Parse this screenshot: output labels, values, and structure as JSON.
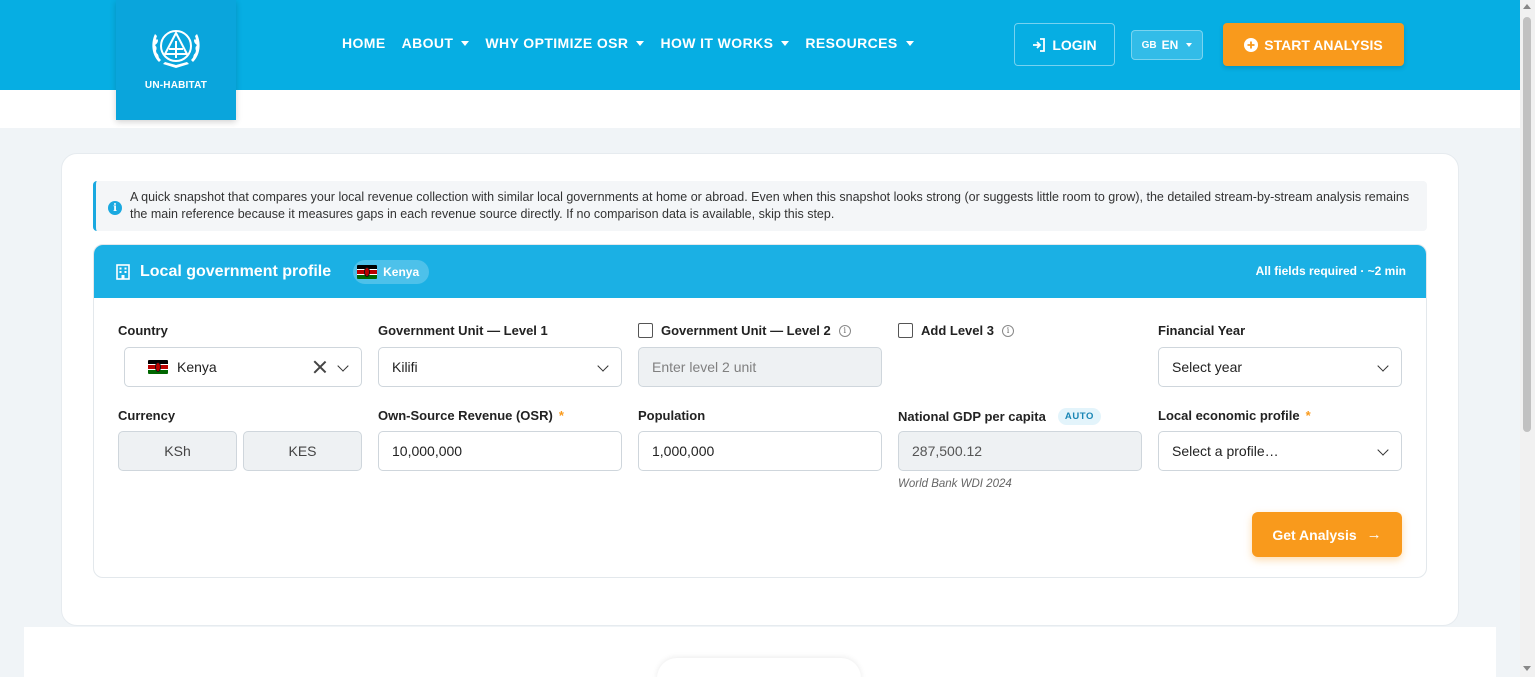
{
  "header": {
    "logo_text": "UN-HABITAT",
    "nav": [
      {
        "label": "HOME",
        "has_dropdown": false
      },
      {
        "label": "ABOUT",
        "has_dropdown": true
      },
      {
        "label": "WHY OPTIMIZE OSR",
        "has_dropdown": true
      },
      {
        "label": "HOW IT WORKS",
        "has_dropdown": true
      },
      {
        "label": "RESOURCES",
        "has_dropdown": true
      }
    ],
    "login_label": "LOGIN",
    "lang_flag": "GB",
    "lang_code": "EN",
    "start_label": "START ANALYSIS"
  },
  "info": {
    "text": "A quick snapshot that compares your local revenue collection with similar local governments at home or abroad. Even when this snapshot looks strong (or suggests little room to grow), the detailed stream-by-stream analysis remains the main reference because it measures gaps in each revenue source directly. If no comparison data is available, skip this step."
  },
  "panel": {
    "title": "Local government profile",
    "country_chip": "Kenya",
    "note": "All fields required · ~2 min"
  },
  "form": {
    "country": {
      "label": "Country",
      "value": "Kenya"
    },
    "level1": {
      "label": "Government Unit — Level 1",
      "value": "Kilifi"
    },
    "level2": {
      "label": "Government Unit — Level 2",
      "placeholder": "Enter level 2 unit"
    },
    "level3": {
      "label": "Add Level 3"
    },
    "year": {
      "label": "Financial Year",
      "placeholder": "Select year"
    },
    "currency": {
      "label": "Currency",
      "symbol": "KSh",
      "code": "KES"
    },
    "osr": {
      "label": "Own-Source Revenue (OSR)",
      "required_mark": "*",
      "value": "10,000,000"
    },
    "population": {
      "label": "Population",
      "value": "1,000,000"
    },
    "gdp": {
      "label": "National GDP per capita",
      "badge": "AUTO",
      "value": "287,500.12",
      "source": "World Bank WDI 2024"
    },
    "profile": {
      "label": "Local economic profile",
      "required_mark": "*",
      "placeholder": "Select a profile…"
    }
  },
  "actions": {
    "get_analysis": "Get Analysis",
    "get_analysis_arrow": "→"
  },
  "colors": {
    "header_blue": "#06aee3",
    "accent_orange": "#f99a1c",
    "panel_blue": "#1bb0e4"
  }
}
